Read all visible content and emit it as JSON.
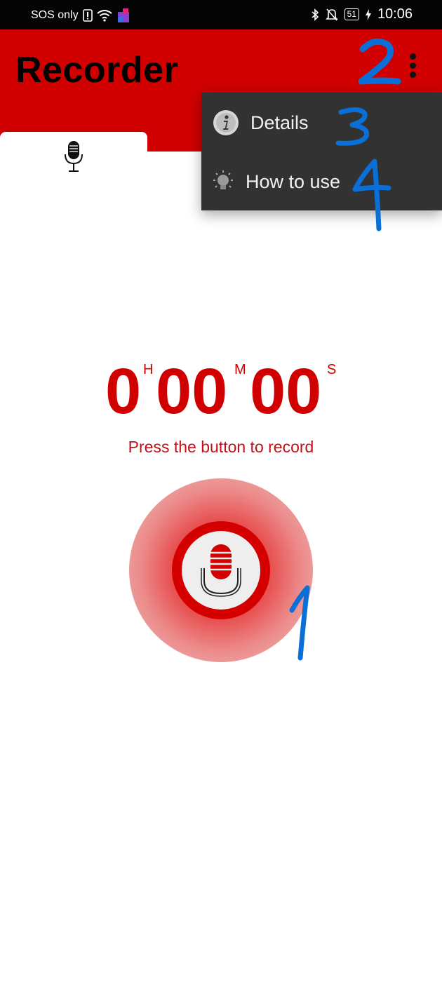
{
  "status_bar": {
    "carrier": "SOS only",
    "battery": "51",
    "time": "10:06"
  },
  "app_bar": {
    "title": "Recorder",
    "tab_icon": "microphone-icon",
    "overflow_icon": "more-vert-icon"
  },
  "overflow_menu": {
    "items": [
      {
        "label": "Details",
        "icon": "info-icon"
      },
      {
        "label": "How to use",
        "icon": "lightbulb-icon"
      }
    ]
  },
  "timer": {
    "hours": "0",
    "minutes": "00",
    "seconds": "00",
    "hours_unit": "H",
    "minutes_unit": "M",
    "seconds_unit": "S"
  },
  "hint": "Press the button to record",
  "record_button": {
    "icon": "microphone-icon"
  },
  "annotations": [
    "1",
    "2",
    "3",
    "4"
  ],
  "colors": {
    "accent": "#d00000",
    "menu_bg": "#323232",
    "annotation": "#0a6fd6"
  }
}
